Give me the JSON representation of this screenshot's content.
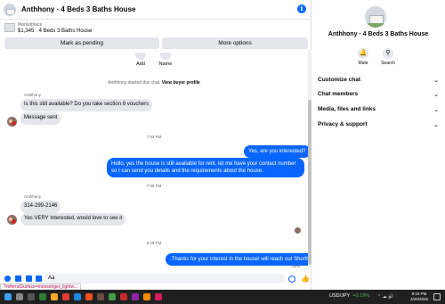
{
  "header": {
    "title": "Anthhony · 4 Beds 3 Baths House",
    "info_icon": "info-icon"
  },
  "marketplace": {
    "label": "Marketplace",
    "listing": "$1,345 · 4 Beds 3 Baths House"
  },
  "actions": {
    "mark_pending": "Mark as pending",
    "more_options": "More options"
  },
  "profile_actions": {
    "add": "Add",
    "name": "Name"
  },
  "system_note": {
    "text": "Anthhony started this chat.",
    "link": "View buyer profile"
  },
  "messages": {
    "sender_1": "Anthhony",
    "in_1": "Is this still available? Do you take section 8 vouchers",
    "in_2": "Message sent",
    "time_1": "7:54 PM",
    "out_1": "Yes, are you interested?",
    "out_2": "Hello, yes the house is still available for rent, let me have your contact number so I can send you details and the requirements about the house.",
    "time_2": "7:58 PM",
    "sender_2": "Anthhony",
    "in_3": "314-299-2146",
    "in_4": "Yes VERY Interested, would love to see it",
    "time_3": "8:19 PM",
    "out_3": ".Thanks for your interest in the house! will reach out Shortly",
    "status": "Sent"
  },
  "composer": {
    "input_value": "Aa",
    "url_status": "?referralSurface=messenger_lightw..."
  },
  "panel": {
    "title": "Anthhony · 4 Beds 3 Baths House",
    "mute": "Mute",
    "search": "Search",
    "sections": [
      "Customize chat",
      "Chat members",
      "Media, files and links",
      "Privacy & support"
    ]
  },
  "taskbar": {
    "ticker": "USD/JPY",
    "change": "+0.19%",
    "time": "9:19 PM",
    "date": "3/26/2025"
  },
  "colors": {
    "accent": "#0866ff",
    "bubble_in": "#e4e6eb",
    "taskbar": "#202020"
  }
}
